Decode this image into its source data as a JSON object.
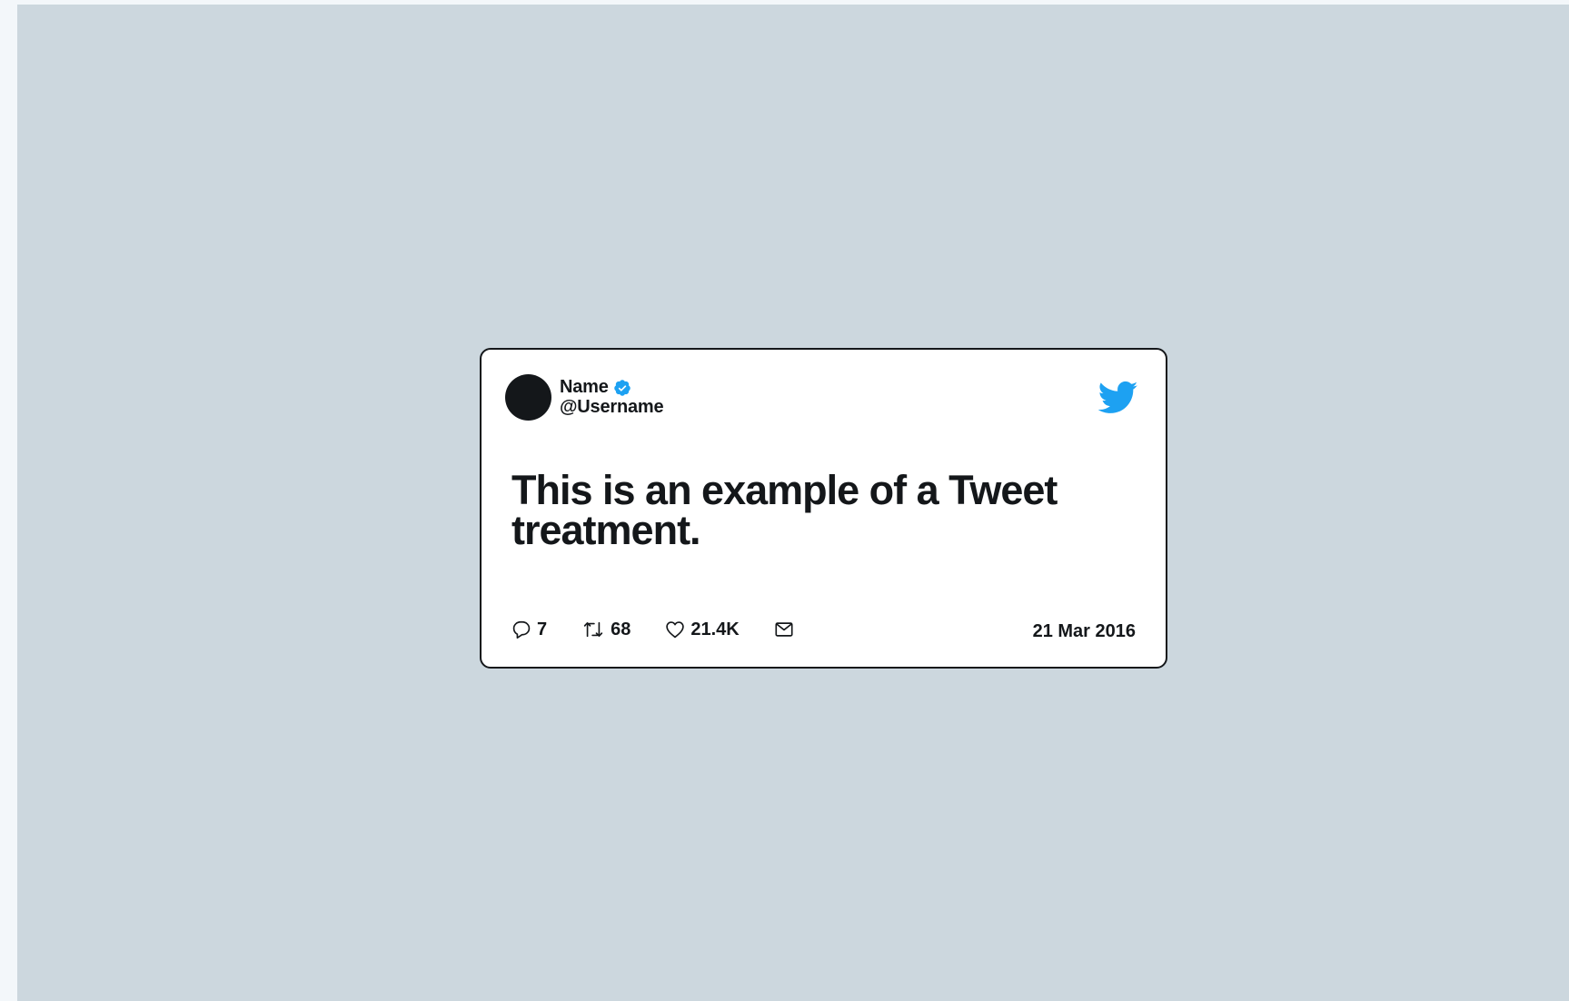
{
  "tweet": {
    "author_name": "Name",
    "username": "@Username",
    "text": "This is an example of a Tweet treatment.",
    "date": "21 Mar 2016",
    "verified": true,
    "actions": {
      "replies": "7",
      "retweets": "68",
      "likes": "21.4K"
    },
    "icons": {
      "verified": "verified-badge-icon",
      "brand": "twitter-bird-icon",
      "reply": "reply-icon",
      "retweet": "retweet-icon",
      "like": "heart-icon",
      "message": "mail-icon"
    }
  },
  "colors": {
    "background": "#ccd7de",
    "card": "#ffffff",
    "text": "#14171a",
    "brand_blue": "#1da1f2"
  }
}
